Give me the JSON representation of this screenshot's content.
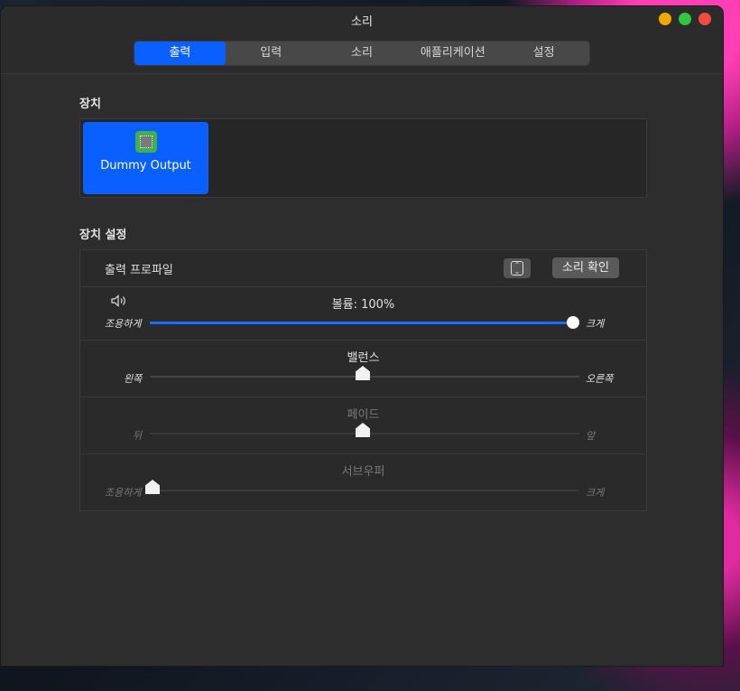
{
  "window": {
    "title": "소리"
  },
  "tabs": [
    {
      "label": "출력",
      "active": true
    },
    {
      "label": "입력",
      "active": false
    },
    {
      "label": "소리",
      "active": false
    },
    {
      "label": "애플리케이션",
      "active": false
    },
    {
      "label": "설정",
      "active": false
    }
  ],
  "devices": {
    "section_label": "장치",
    "items": [
      {
        "name": "Dummy Output",
        "icon": "chip-icon",
        "selected": true
      }
    ]
  },
  "device_settings": {
    "section_label": "장치 설정",
    "output_profile": {
      "label": "출력 프로파일",
      "test_button": "소리 확인"
    },
    "volume": {
      "label": "볼륨: 100%",
      "value": 1.0,
      "min_label": "조용하게",
      "max_label": "크게"
    },
    "balance": {
      "label": "밸런스",
      "value": 0.5,
      "left_label": "왼쪽",
      "right_label": "오른쪽"
    },
    "fade": {
      "label": "페이드",
      "value": 0.5,
      "left_label": "뒤",
      "right_label": "앞"
    },
    "subwoofer": {
      "label": "서브우퍼",
      "value": 0.0,
      "min_label": "조용하게",
      "max_label": "크게"
    }
  },
  "colors": {
    "accent": "#0a60ff",
    "chip": "#3fb04a"
  }
}
